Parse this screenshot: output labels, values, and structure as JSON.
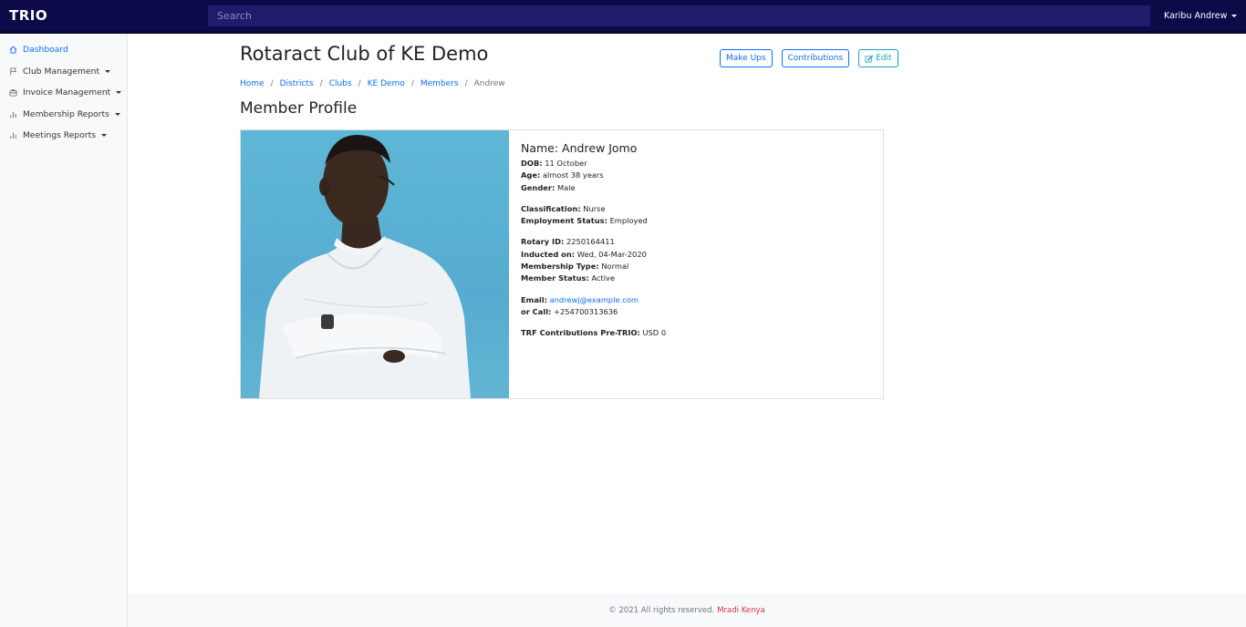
{
  "app": {
    "brand": "TRIO"
  },
  "search": {
    "placeholder": "Search"
  },
  "user": {
    "greeting": "Karibu Andrew"
  },
  "sidebar": {
    "items": [
      {
        "label": "Dashboard",
        "icon": "home-icon",
        "active": true,
        "dropdown": false
      },
      {
        "label": "Club Management",
        "icon": "flag-icon",
        "active": false,
        "dropdown": true
      },
      {
        "label": "Invoice Management",
        "icon": "briefcase-icon",
        "active": false,
        "dropdown": true
      },
      {
        "label": "Membership Reports",
        "icon": "bar-chart-icon",
        "active": false,
        "dropdown": true
      },
      {
        "label": "Meetings Reports",
        "icon": "bar-chart-icon",
        "active": false,
        "dropdown": true
      }
    ]
  },
  "page": {
    "title": "Rotaract Club of KE Demo",
    "section_title": "Member Profile"
  },
  "actions": {
    "makeups": "Make Ups",
    "contributions": "Contributions",
    "edit": "Edit"
  },
  "breadcrumb": {
    "items": [
      "Home",
      "Districts",
      "Clubs",
      "KE Demo",
      "Members"
    ],
    "current": "Andrew"
  },
  "profile": {
    "name_line": "Name: Andrew Jomo",
    "dob_label": "DOB:",
    "dob": "11 October",
    "age_label": "Age:",
    "age": "almost 38 years",
    "gender_label": "Gender:",
    "gender": "Male",
    "classification_label": "Classification:",
    "classification": "Nurse",
    "employment_label": "Employment Status:",
    "employment": "Employed",
    "rotary_id_label": "Rotary ID:",
    "rotary_id": "2250164411",
    "inducted_label": "Inducted on:",
    "inducted": "Wed, 04-Mar-2020",
    "membership_type_label": "Membership Type:",
    "membership_type": "Normal",
    "member_status_label": "Member Status:",
    "member_status": "Active",
    "email_label": "Email:",
    "email": "andrewj@example.com",
    "call_label": "or Call:",
    "call": "+254700313636",
    "trf_label": "TRF Contributions Pre-TRIO:",
    "trf": "USD 0"
  },
  "footer": {
    "text": "© 2021 All rights reserved.",
    "company": "Mradi Kenya"
  },
  "colors": {
    "navbar": "#0d0a4a",
    "primary": "#0d6efd",
    "teal": "#17a2b8",
    "footer_link": "#dc3545"
  }
}
